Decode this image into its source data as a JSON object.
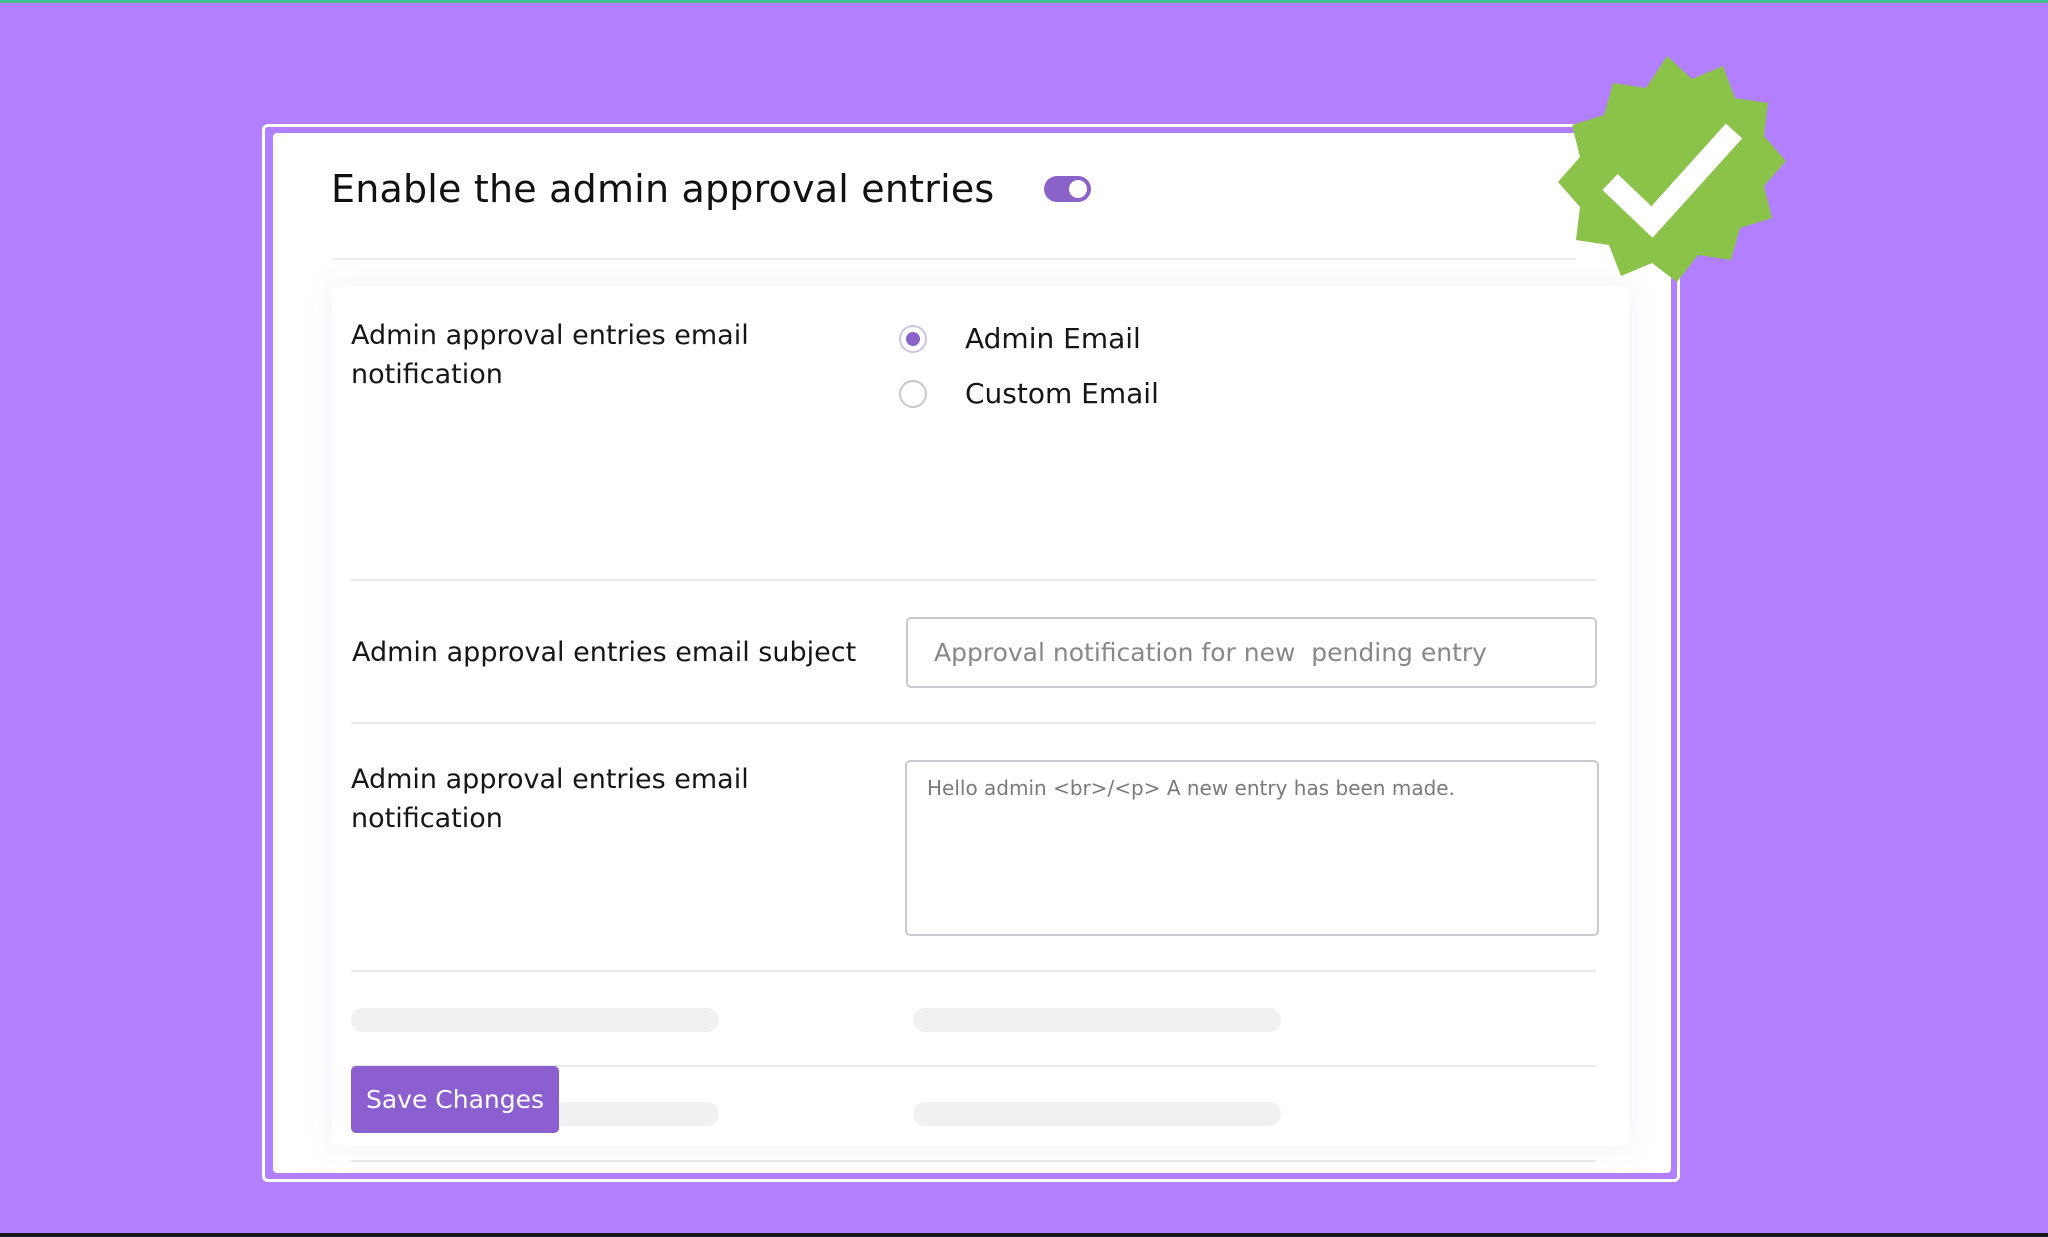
{
  "header": {
    "title": "Enable the admin approval entries",
    "toggle_on": true
  },
  "notification_row": {
    "label": "Admin approval entries email notification",
    "options": [
      {
        "label": "Admin Email",
        "checked": true
      },
      {
        "label": "Custom Email",
        "checked": false
      }
    ]
  },
  "subject_row": {
    "label": "Admin approval entries email subject",
    "placeholder": "Approval notification for new  pending entry"
  },
  "body_row": {
    "label": "Admin approval entries email notification",
    "placeholder": "Hello admin <br>/<p> A new entry has been made."
  },
  "save_label": "Save Changes",
  "colors": {
    "background": "#b17fff",
    "accent": "#8b5fcf",
    "badge": "#8bc34a"
  },
  "icons": {
    "badge": "verified-check-badge-icon"
  }
}
